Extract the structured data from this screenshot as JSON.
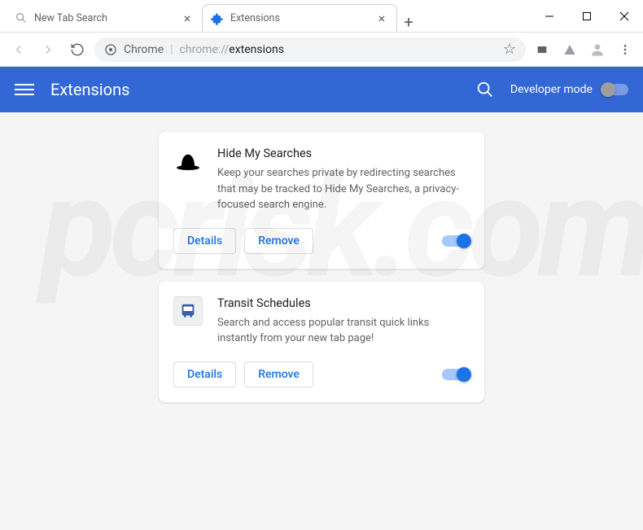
{
  "window": {
    "watermark": "pcrisk.com"
  },
  "tabs": [
    {
      "title": "New Tab Search",
      "active": false,
      "icon": "search-icon"
    },
    {
      "title": "Extensions",
      "active": true,
      "icon": "puzzle-icon"
    }
  ],
  "omnibox": {
    "site_label": "Chrome",
    "path_protocol": "chrome://",
    "path_page": "extensions"
  },
  "header": {
    "title": "Extensions",
    "dev_mode_label": "Developer mode",
    "dev_mode_enabled": false
  },
  "extensions": [
    {
      "name": "Hide My Searches",
      "description": "Keep your searches private by redirecting searches that may be tracked to Hide My Searches, a privacy-focused search engine.",
      "icon": "hat",
      "enabled": true,
      "details_label": "Details",
      "remove_label": "Remove"
    },
    {
      "name": "Transit Schedules",
      "description": "Search and access popular transit quick links instantly from your new tab page!",
      "icon": "bus",
      "enabled": true,
      "details_label": "Details",
      "remove_label": "Remove"
    }
  ]
}
